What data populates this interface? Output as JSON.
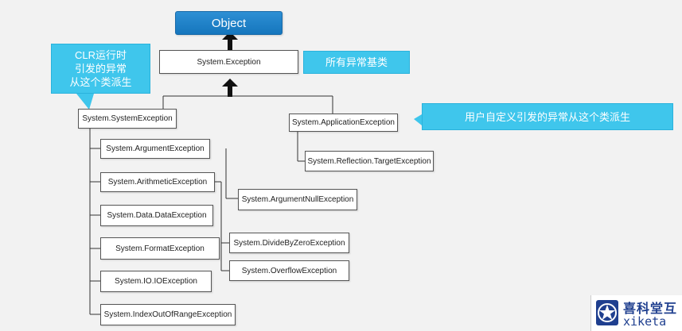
{
  "nodes": {
    "object": "Object",
    "exception": "System.Exception",
    "system_exception": "System.SystemException",
    "application_exception": "System.ApplicationException",
    "target_exception": "System.Reflection.TargetException",
    "argument_exception": "System.ArgumentException",
    "argument_null_exception": "System.ArgumentNullException",
    "arithmetic_exception": "System.ArithmeticException",
    "divide_by_zero_exception": "System.DivideByZeroException",
    "overflow_exception": "System.OverflowException",
    "data_exception": "System.Data.DataException",
    "format_exception": "System.FormatException",
    "io_exception": "System.IO.IOException",
    "index_out_of_range_exception": "System.IndexOutOfRangeException"
  },
  "callouts": {
    "base": "所有异常基类",
    "clr_line1": "CLR运行时",
    "clr_line2": "引发的异常",
    "clr_line3": "从这个类派生",
    "user": "用户自定义引发的异常从这个类派生"
  },
  "logo": {
    "cn": "喜科堂互",
    "en": "xiketa",
    "badge_icon": "star-shield-icon"
  },
  "colors": {
    "object_fill": "#1576bd",
    "callout_fill": "#3fc6ec",
    "line": "#333333"
  }
}
